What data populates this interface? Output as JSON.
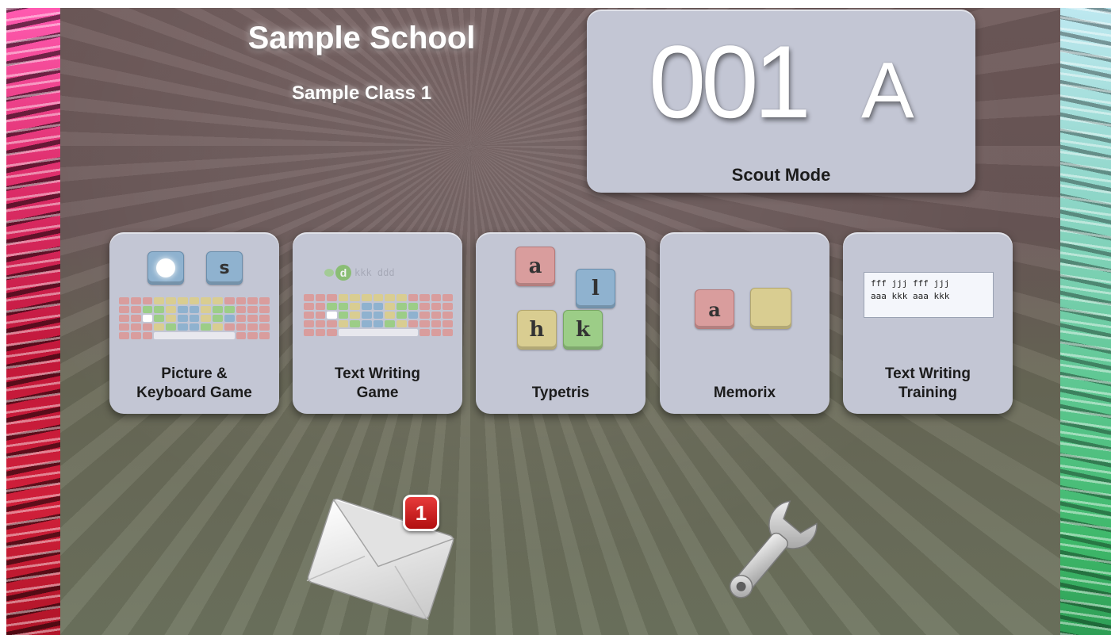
{
  "header": {
    "school": "Sample School",
    "class": "Sample Class 1"
  },
  "scout": {
    "number": "001",
    "letter": "A",
    "label": "Scout Mode"
  },
  "tiles": [
    {
      "label_line1": "Picture &",
      "label_line2": "Keyboard Game",
      "key_label": "s"
    },
    {
      "label_line1": "Text Writing",
      "label_line2": "Game",
      "bubble_letter": "d",
      "preview": "kkk ddd"
    },
    {
      "label_line1": "Typetris",
      "keys": [
        "a",
        "l",
        "h",
        "k"
      ]
    },
    {
      "label_line1": "Memorix",
      "key": "a"
    },
    {
      "label_line1": "Text Writing",
      "label_line2": "Training",
      "line1": "fff jjj fff jjj",
      "line2": "aaa kkk aaa kkk"
    }
  ],
  "messages": {
    "unread_count": "1"
  },
  "icons": {
    "mail": "envelope-icon",
    "settings": "wrench-icon"
  },
  "colors": {
    "panel": "#c3c6d4",
    "badge": "#d11f1f",
    "key_pink": "#d99d9d",
    "key_blue": "#8fb2cf",
    "key_yellow": "#d9cd91",
    "key_green": "#9ccd87"
  }
}
